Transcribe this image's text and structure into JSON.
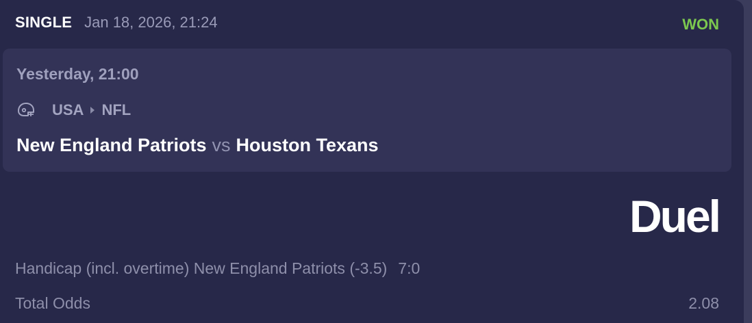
{
  "bet": {
    "type": "SINGLE",
    "placed_at": "Jan 18, 2026, 21:24",
    "status": "WON",
    "status_color": "#7cc84f"
  },
  "event": {
    "time": "Yesterday, 21:00",
    "sport_icon": "american-football-helmet-icon",
    "country": "USA",
    "league": "NFL",
    "home_team": "New England Patriots",
    "vs": "vs",
    "away_team": "Houston Texans"
  },
  "brand": {
    "name": "Duel"
  },
  "selection": {
    "market": "Handicap (incl. overtime) New England Patriots (-3.5)",
    "score": "7:0"
  },
  "odds": {
    "label": "Total Odds",
    "value": "2.08"
  }
}
